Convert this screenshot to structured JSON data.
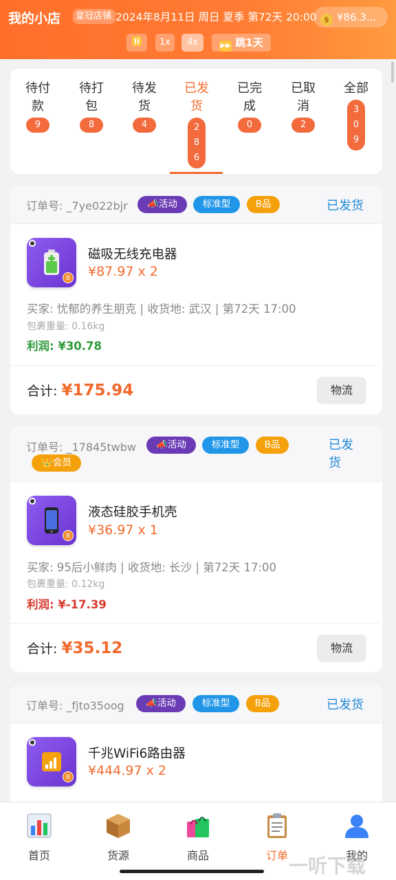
{
  "header": {
    "app_title": "我的小店",
    "shop_tag": "皇冠店铺",
    "date_text": "2024年8月11日 周日 夏季 第72天 20:00",
    "money": "¥86.3...",
    "speed_1x": "1x",
    "speed_4x": "4x",
    "jump_label": "跳1天"
  },
  "tabs": [
    {
      "label": "待付款",
      "count": "9"
    },
    {
      "label": "待打包",
      "count": "8"
    },
    {
      "label": "待发货",
      "count": "4"
    },
    {
      "label": "已发货",
      "count": "286"
    },
    {
      "label": "已完成",
      "count": "0"
    },
    {
      "label": "已取消",
      "count": "2"
    },
    {
      "label": "全部",
      "count": "309"
    }
  ],
  "orders": [
    {
      "order_no": "订单号: _7ye022bjr",
      "badge_activity": "📣活动",
      "badge_type": "标准型",
      "badge_grade": "B品",
      "status": "已发货",
      "product_name": "磁吸无线充电器",
      "price_qty": "¥87.97 x 2",
      "buyer_line": "买家: 忧郁的养生朋克 | 收货地: 武汉 | 第72天 17:00",
      "weight_line": "包裹重量: 0.16kg",
      "profit_line": "利润: ¥30.78",
      "total_label": "合计:",
      "total_value": "¥175.94",
      "logistics": "物流"
    },
    {
      "order_no": "订单号: _17845twbw",
      "badge_activity": "📣活动",
      "badge_type": "标准型",
      "badge_grade": "B品",
      "badge_member": "👑会员",
      "status": "已发货",
      "product_name": "液态硅胶手机壳",
      "price_qty": "¥36.97 x 1",
      "buyer_line": "买家: 95后小鲜肉 | 收货地: 长沙 | 第72天 17:00",
      "weight_line": "包裹重量: 0.12kg",
      "profit_line": "利润: ¥-17.39",
      "total_label": "合计:",
      "total_value": "¥35.12",
      "logistics": "物流"
    },
    {
      "order_no": "订单号: _fjto35oog",
      "badge_activity": "📣活动",
      "badge_type": "标准型",
      "badge_grade": "B品",
      "status": "已发货",
      "product_name": "千兆WiFi6路由器",
      "price_qty": "¥444.97 x 2"
    }
  ],
  "nav": [
    {
      "label": "首页"
    },
    {
      "label": "货源"
    },
    {
      "label": "商品"
    },
    {
      "label": "订单"
    },
    {
      "label": "我的"
    }
  ],
  "watermark": "一听下载",
  "colors": {
    "header_orange": "#ff7b33",
    "accent": "#f26c2d",
    "status_blue": "#1e88d6",
    "profit_green": "#2f9a3c",
    "loss_red": "#d63a2f"
  },
  "icons": {
    "product_1": "battery-charger-icon",
    "product_2": "phone-case-icon",
    "product_3": "wifi-signal-icon"
  }
}
